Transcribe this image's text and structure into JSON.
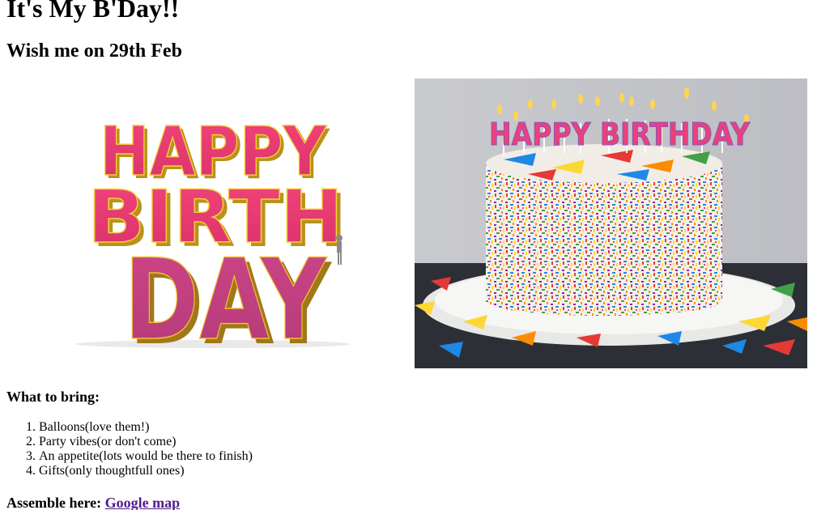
{
  "header": {
    "title": "It's My B'Day!!",
    "subtitle": "Wish me on 29th Feb"
  },
  "images": {
    "happy_birthday_text_art": {
      "lines": [
        "HAPPY",
        "BIRTH",
        "DAY"
      ]
    },
    "birthday_cake_photo": {
      "candle_text": "HAPPY BIRTHDAY"
    }
  },
  "bring": {
    "heading": "What to bring:",
    "items": [
      "Balloons(love them!)",
      "Party vibes(or don't come)",
      "An appetite(lots would be there to finish)",
      "Gifts(only thoughtfull ones)"
    ]
  },
  "assemble": {
    "label": "Assemble here: ",
    "link_text": "Google map"
  },
  "colors": {
    "link_visited": "#551a8b",
    "text_art_pink": "#e8356f",
    "text_art_magenta": "#c23e80",
    "text_art_gold": "#e0b21a"
  }
}
